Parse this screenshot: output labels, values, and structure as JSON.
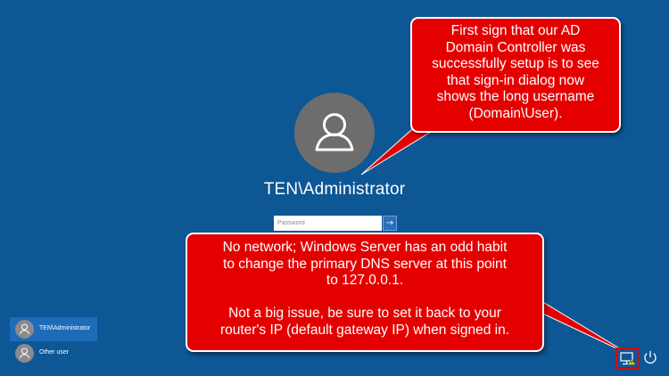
{
  "login": {
    "username": "TEN\\Administrator",
    "password_placeholder": "Password",
    "submit_arrow": "→"
  },
  "user_list": [
    {
      "label": "TEN\\Administrator",
      "selected": true
    },
    {
      "label": "Other user",
      "selected": false
    }
  ],
  "callouts": {
    "top": "First sign that our AD\nDomain Controller was\nsuccessfully setup is to see\nthat sign-in dialog now\nshows the long username\n(Domain\\User).",
    "bottom": "No network; Windows Server has an odd habit\nto change the primary DNS server at this point\nto 127.0.0.1.\n\nNot a big issue, be sure to set it back to your\nrouter's IP (default gateway IP) when signed in."
  },
  "icons": {
    "user": "user-icon",
    "network": "network-icon",
    "power": "power-icon",
    "arrow": "arrow-right-icon"
  },
  "colors": {
    "background": "#0d5795",
    "callout": "#e50000",
    "selected_user": "#1e6cb8",
    "avatar": "#6d6d6d"
  }
}
